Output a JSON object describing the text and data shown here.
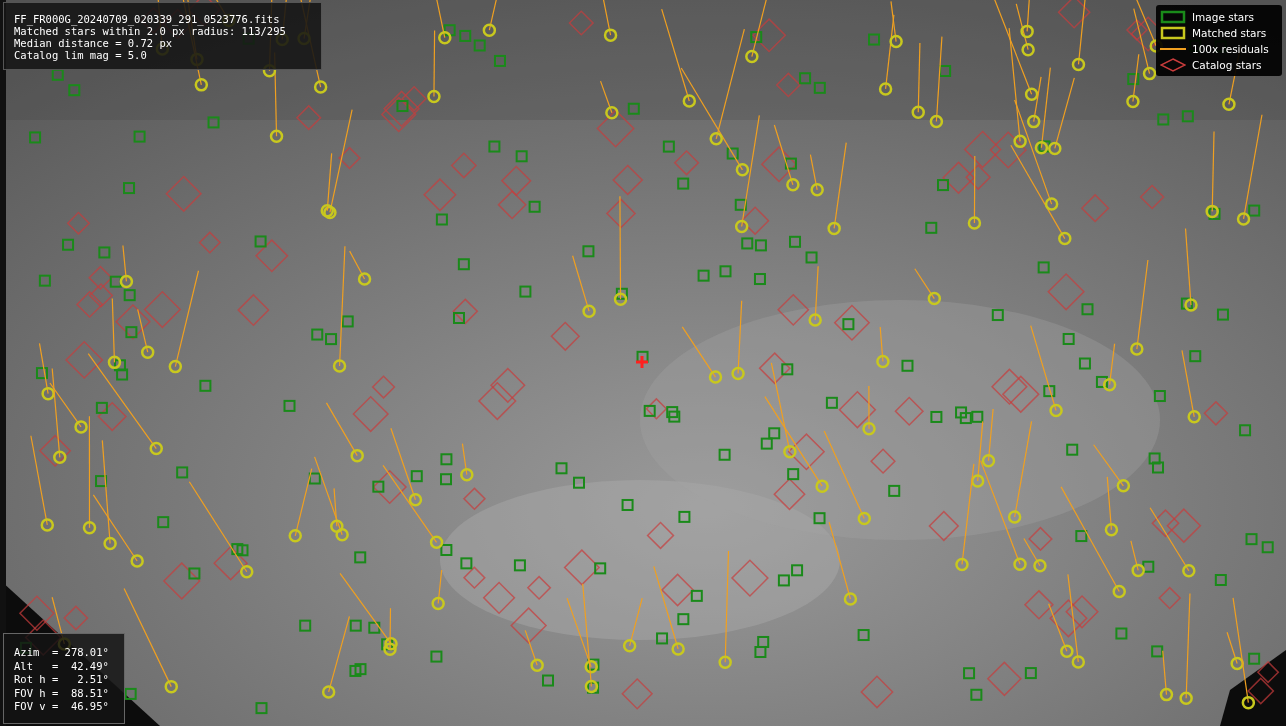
{
  "info_box": {
    "lines": [
      "FF_FR000G_20240709_020339_291_0523776.fits",
      "Matched stars within 2.0 px radius: 113/295",
      "Median distance = 0.72 px",
      "Catalog lim mag = 5.0"
    ]
  },
  "legend": {
    "items": [
      {
        "label": "Image stars",
        "kind": "box",
        "color": "#1a8a1a"
      },
      {
        "label": "Matched stars",
        "kind": "box",
        "color": "#c8c81e"
      },
      {
        "label": "100x residuals",
        "kind": "line",
        "color": "#f0a020"
      },
      {
        "label": "Catalog stars",
        "kind": "diamond",
        "color": "#c83c3c"
      }
    ]
  },
  "pointing_box": {
    "lines": [
      "Azim  = 278.01°",
      "Alt   =  42.49°",
      "Rot h =   2.51°",
      "FOV h =  88.51°",
      "FOV v =  46.95°"
    ]
  }
}
